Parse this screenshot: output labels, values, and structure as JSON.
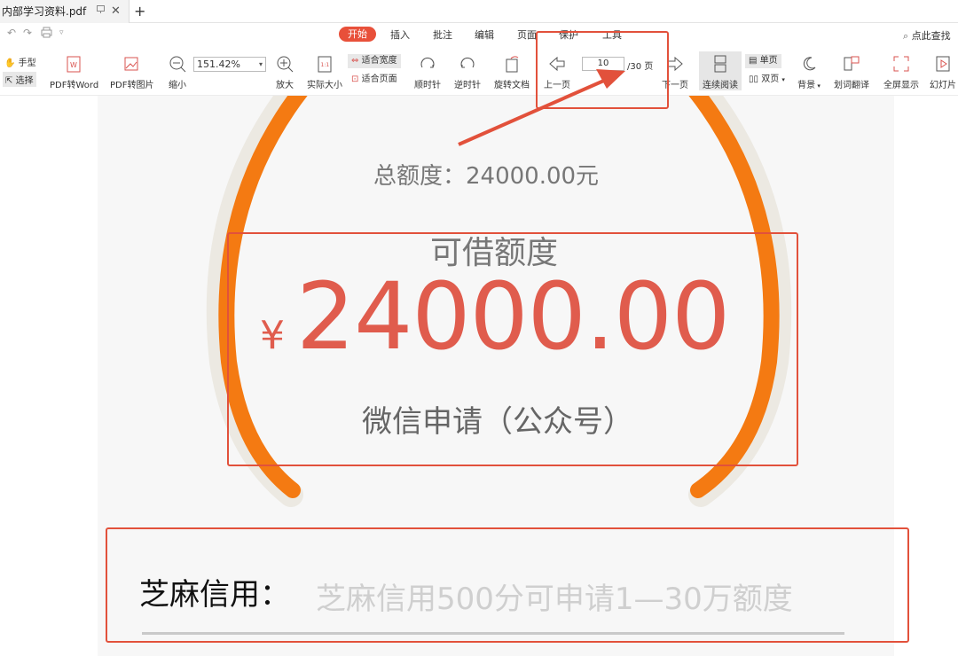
{
  "tab": {
    "title": "内部学习资料.pdf",
    "new_tab": "+"
  },
  "menu": {
    "active": "开始",
    "items": [
      "插入",
      "批注",
      "编辑",
      "页面",
      "保护",
      "工具"
    ],
    "search_hint": "点此查找"
  },
  "toolbar": {
    "hand": "手型",
    "select": "选择",
    "pdf_to_word": "PDF转Word",
    "pdf_to_image": "PDF转图片",
    "zoom_out": "缩小",
    "zoom_value": "151.42%",
    "zoom_in": "放大",
    "actual_size": "实际大小",
    "fit_width": "适合宽度",
    "fit_page": "适合页面",
    "rotate_cw": "顺时针",
    "rotate_ccw": "逆时针",
    "rotate_doc": "旋转文档",
    "prev_page": "上一页",
    "page_current": "10",
    "page_total": "/30 页",
    "next_page": "下一页",
    "continuous": "连续阅读",
    "single": "单页",
    "double": "双页",
    "background": "背景",
    "translate": "划词翻译",
    "fullscreen": "全屏显示",
    "slides": "幻灯片"
  },
  "document": {
    "total_line": "总额度：24000.00元",
    "available_label": "可借额度",
    "currency": "¥",
    "amount": "24000.00",
    "apply_via": "微信申请（公众号）",
    "zhima_label": "芝麻信用：",
    "zhima_value": "芝麻信用500分可申请1—30万额度"
  },
  "colors": {
    "accent": "#e8503a",
    "arc": "#f47a12",
    "annotation": "#e2513b",
    "amount": "#e05c4d"
  }
}
